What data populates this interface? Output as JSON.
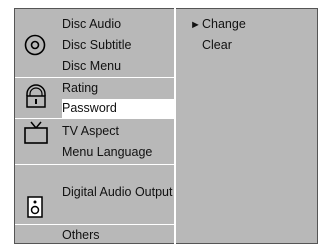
{
  "menu": {
    "groups": [
      {
        "icon": "disc-icon",
        "items": [
          "Disc Audio",
          "Disc Subtitle",
          "Disc Menu"
        ]
      },
      {
        "icon": "lock-icon",
        "items": [
          "Rating",
          "Password"
        ]
      },
      {
        "icon": "tv-icon",
        "items": [
          "TV Aspect",
          "Menu Language"
        ]
      },
      {
        "icon": "speaker-icon",
        "items": [
          "Digital Audio Output"
        ]
      },
      {
        "icon": "",
        "items": [
          "Others"
        ]
      }
    ],
    "selected": "Password"
  },
  "submenu": {
    "items": [
      "Change",
      "Clear"
    ],
    "selected": "Change",
    "arrow": "►"
  },
  "colors": {
    "panel": "#b8b8b8",
    "highlight": "#ffffff",
    "divider": "#ffffff"
  }
}
